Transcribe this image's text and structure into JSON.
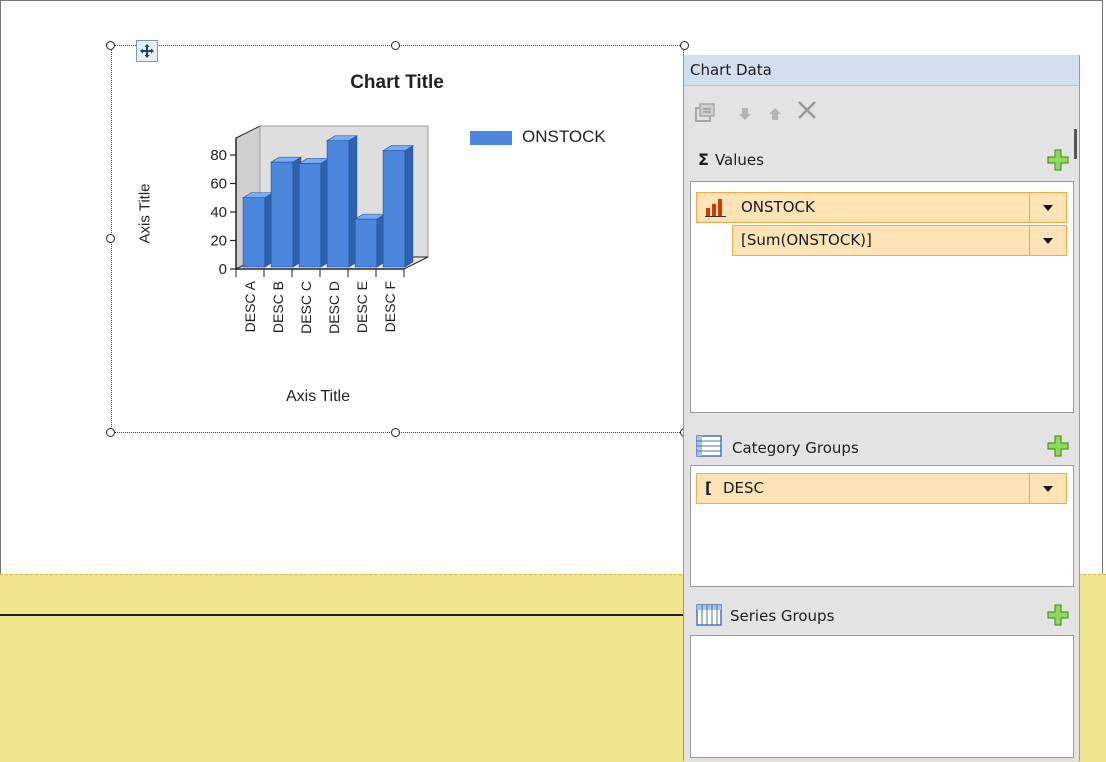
{
  "chart": {
    "title": "Chart Title",
    "y_axis_title": "Axis Title",
    "x_axis_title": "Axis Title",
    "legend_label": "ONSTOCK"
  },
  "chart_data": {
    "type": "bar",
    "title": "Chart Title",
    "xlabel": "Axis Title",
    "ylabel": "Axis Title",
    "categories": [
      "DESC A",
      "DESC B",
      "DESC C",
      "DESC D",
      "DESC E",
      "DESC F"
    ],
    "series": [
      {
        "name": "ONSTOCK",
        "values": [
          50,
          75,
          74,
          90,
          35,
          83
        ]
      }
    ],
    "ylim": [
      0,
      80
    ],
    "yticks": [
      "0",
      "20",
      "40",
      "60",
      "80"
    ],
    "legend_position": "top-right",
    "grid": false,
    "style": "3d-clustered-column",
    "colors": {
      "bar": "#4d87dd",
      "bar_side": "#2f62ad",
      "bar_top": "#7aaaf0",
      "wall": "#d9d9d9"
    }
  },
  "panel": {
    "title": "Chart Data",
    "toolbar": {
      "properties_icon": "properties-icon",
      "move_down_icon": "arrow-down-icon",
      "move_up_icon": "arrow-up-icon",
      "delete_icon": "delete-x-icon"
    },
    "values": {
      "label": "Values",
      "symbol": "Σ",
      "field": "ONSTOCK",
      "expression": "[Sum(ONSTOCK)]"
    },
    "category_groups": {
      "label": "Category Groups",
      "field_symbol": "[",
      "field": "DESC"
    },
    "series_groups": {
      "label": "Series Groups"
    }
  },
  "colors": {
    "panel_bg": "#e3e3e3",
    "panel_header_bg": "#d2dfee",
    "field_bg": "#fde3b5",
    "field_border": "#f1a94a",
    "plus_green": "#5fb52a",
    "band_yellow": "#f0e48e"
  }
}
